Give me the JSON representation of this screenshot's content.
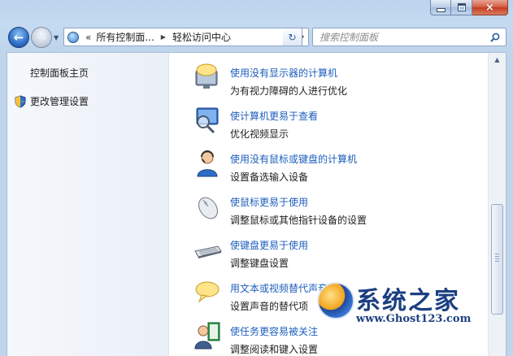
{
  "window": {
    "caption": {
      "minimize": "minimize-icon",
      "maximize": "maximize-icon",
      "close": "×"
    }
  },
  "navbar": {
    "address": {
      "overflow": "«",
      "segments": [
        "所有控制面...",
        "轻松访问中心"
      ]
    },
    "search_placeholder": "搜索控制面板"
  },
  "leftpane": {
    "home_label": "控制面板主页",
    "admin_label": "更改管理设置"
  },
  "items": [
    {
      "title": "使用没有显示器的计算机",
      "desc": "为有视力障碍的人进行优化",
      "icon": "monitor-speech-icon"
    },
    {
      "title": "使计算机更易于查看",
      "desc": "优化视频显示",
      "icon": "magnifier-monitor-icon"
    },
    {
      "title": "使用没有鼠标或键盘的计算机",
      "desc": "设置备选输入设备",
      "icon": "person-headset-icon"
    },
    {
      "title": "使鼠标更易于使用",
      "desc": "调整鼠标或其他指针设备的设置",
      "icon": "mouse-icon"
    },
    {
      "title": "使键盘更易于使用",
      "desc": "调整键盘设置",
      "icon": "keyboard-icon"
    },
    {
      "title": "用文本或视频替代声音",
      "desc": "设置声音的替代项",
      "icon": "speech-bubble-icon"
    },
    {
      "title": "使任务更容易被关注",
      "desc": "调整阅读和键入设置",
      "icon": "person-book-icon"
    }
  ],
  "watermark": {
    "title": "系统之家",
    "url": "www.Ghost123.com"
  },
  "colors": {
    "link": "#1d5ebc",
    "frame": "#c4daf0"
  }
}
